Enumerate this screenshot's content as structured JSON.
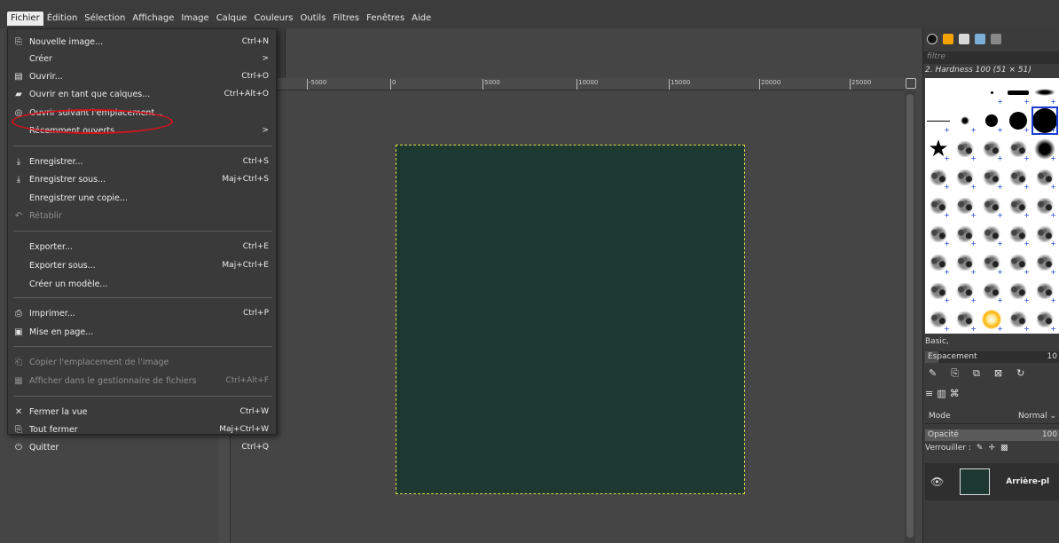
{
  "menubar": {
    "items": [
      "Fichier",
      "Édition",
      "Sélection",
      "Affichage",
      "Image",
      "Calque",
      "Couleurs",
      "Outils",
      "Filtres",
      "Fenêtres",
      "Aide"
    ]
  },
  "file_menu": {
    "items": [
      {
        "icon": "new-image-icon",
        "label": "Nouvelle image...",
        "shortcut": "Ctrl+N"
      },
      {
        "icon": "",
        "label": "Créer",
        "shortcut": ">"
      },
      {
        "icon": "open-icon",
        "label": "Ouvrir...",
        "shortcut": "Ctrl+O"
      },
      {
        "icon": "open-as-layers-icon",
        "label": "Ouvrir en tant que calques...",
        "shortcut": "Ctrl+Alt+O"
      },
      {
        "icon": "open-location-icon",
        "label": "Ouvrir suivant l'emplacement...",
        "shortcut": ""
      },
      {
        "icon": "",
        "label": "Récemment ouverts",
        "shortcut": ">"
      },
      {
        "icon": "save-icon",
        "label": "Enregistrer...",
        "shortcut": "Ctrl+S"
      },
      {
        "icon": "save-as-icon",
        "label": "Enregistrer sous...",
        "shortcut": "Maj+Ctrl+S"
      },
      {
        "icon": "",
        "label": "Enregistrer une copie...",
        "shortcut": ""
      },
      {
        "icon": "revert-icon",
        "label": "Rétablir",
        "shortcut": ""
      },
      {
        "icon": "",
        "label": "Exporter...",
        "shortcut": "Ctrl+E"
      },
      {
        "icon": "",
        "label": "Exporter sous...",
        "shortcut": "Maj+Ctrl+E"
      },
      {
        "icon": "",
        "label": "Créer un modèle...",
        "shortcut": ""
      },
      {
        "icon": "print-icon",
        "label": "Imprimer...",
        "shortcut": "Ctrl+P"
      },
      {
        "icon": "page-setup-icon",
        "label": "Mise en page...",
        "shortcut": ""
      },
      {
        "icon": "copy-location-icon",
        "label": "Copier l'emplacement de l'image",
        "shortcut": ""
      },
      {
        "icon": "file-manager-icon",
        "label": "Afficher dans le gestionnaire de fichiers",
        "shortcut": "Ctrl+Alt+F"
      },
      {
        "icon": "close-view-icon",
        "label": "Fermer la vue",
        "shortcut": "Ctrl+W"
      },
      {
        "icon": "close-all-icon",
        "label": "Tout fermer",
        "shortcut": "Maj+Ctrl+W"
      },
      {
        "icon": "quit-icon",
        "label": "Quitter",
        "shortcut": "Ctrl+Q"
      }
    ]
  },
  "ruler": {
    "ticks": [
      "-5000",
      "0",
      "5000",
      "10000",
      "15000",
      "20000",
      "25000"
    ]
  },
  "brushes": {
    "filter_placeholder": "filtre",
    "selected_name": "2. Hardness 100 (51 × 51)",
    "tag": "Basic,",
    "spacing_label": "Espacement",
    "spacing_value": "10",
    "spacing_fraction": 0.1
  },
  "layers": {
    "mode_label": "Mode",
    "mode_value": "Normal",
    "opacity_label": "Opacité",
    "opacity_value": "100",
    "opacity_fraction": 1.0,
    "lock_label": "Verrouiller :",
    "layer_name": "Arrière-pl",
    "layer_color": "#1d3932"
  },
  "canvas": {
    "fill_color": "#1d3932",
    "selection_color": "#e0d84a"
  },
  "colors": {
    "highlight_ellipse": "#d5131a"
  }
}
